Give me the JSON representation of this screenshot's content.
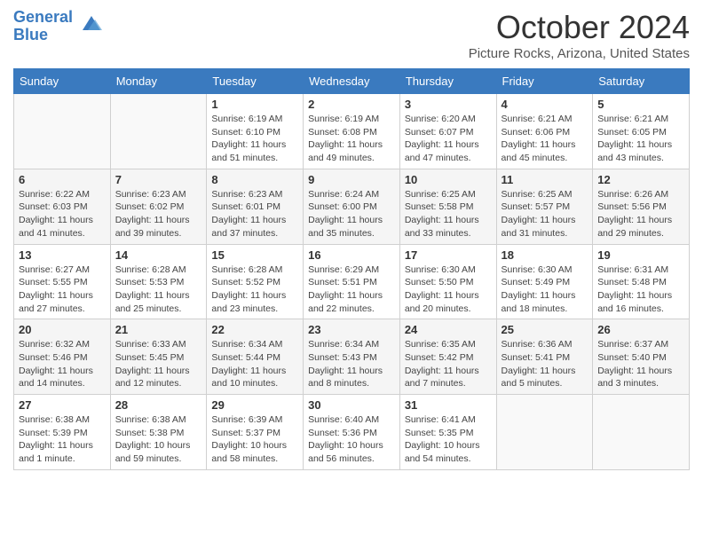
{
  "header": {
    "logo_text_general": "General",
    "logo_text_blue": "Blue",
    "month_title": "October 2024",
    "location": "Picture Rocks, Arizona, United States"
  },
  "calendar": {
    "days_of_week": [
      "Sunday",
      "Monday",
      "Tuesday",
      "Wednesday",
      "Thursday",
      "Friday",
      "Saturday"
    ],
    "weeks": [
      [
        {
          "day": "",
          "info": ""
        },
        {
          "day": "",
          "info": ""
        },
        {
          "day": "1",
          "info": "Sunrise: 6:19 AM\nSunset: 6:10 PM\nDaylight: 11 hours and 51 minutes."
        },
        {
          "day": "2",
          "info": "Sunrise: 6:19 AM\nSunset: 6:08 PM\nDaylight: 11 hours and 49 minutes."
        },
        {
          "day": "3",
          "info": "Sunrise: 6:20 AM\nSunset: 6:07 PM\nDaylight: 11 hours and 47 minutes."
        },
        {
          "day": "4",
          "info": "Sunrise: 6:21 AM\nSunset: 6:06 PM\nDaylight: 11 hours and 45 minutes."
        },
        {
          "day": "5",
          "info": "Sunrise: 6:21 AM\nSunset: 6:05 PM\nDaylight: 11 hours and 43 minutes."
        }
      ],
      [
        {
          "day": "6",
          "info": "Sunrise: 6:22 AM\nSunset: 6:03 PM\nDaylight: 11 hours and 41 minutes."
        },
        {
          "day": "7",
          "info": "Sunrise: 6:23 AM\nSunset: 6:02 PM\nDaylight: 11 hours and 39 minutes."
        },
        {
          "day": "8",
          "info": "Sunrise: 6:23 AM\nSunset: 6:01 PM\nDaylight: 11 hours and 37 minutes."
        },
        {
          "day": "9",
          "info": "Sunrise: 6:24 AM\nSunset: 6:00 PM\nDaylight: 11 hours and 35 minutes."
        },
        {
          "day": "10",
          "info": "Sunrise: 6:25 AM\nSunset: 5:58 PM\nDaylight: 11 hours and 33 minutes."
        },
        {
          "day": "11",
          "info": "Sunrise: 6:25 AM\nSunset: 5:57 PM\nDaylight: 11 hours and 31 minutes."
        },
        {
          "day": "12",
          "info": "Sunrise: 6:26 AM\nSunset: 5:56 PM\nDaylight: 11 hours and 29 minutes."
        }
      ],
      [
        {
          "day": "13",
          "info": "Sunrise: 6:27 AM\nSunset: 5:55 PM\nDaylight: 11 hours and 27 minutes."
        },
        {
          "day": "14",
          "info": "Sunrise: 6:28 AM\nSunset: 5:53 PM\nDaylight: 11 hours and 25 minutes."
        },
        {
          "day": "15",
          "info": "Sunrise: 6:28 AM\nSunset: 5:52 PM\nDaylight: 11 hours and 23 minutes."
        },
        {
          "day": "16",
          "info": "Sunrise: 6:29 AM\nSunset: 5:51 PM\nDaylight: 11 hours and 22 minutes."
        },
        {
          "day": "17",
          "info": "Sunrise: 6:30 AM\nSunset: 5:50 PM\nDaylight: 11 hours and 20 minutes."
        },
        {
          "day": "18",
          "info": "Sunrise: 6:30 AM\nSunset: 5:49 PM\nDaylight: 11 hours and 18 minutes."
        },
        {
          "day": "19",
          "info": "Sunrise: 6:31 AM\nSunset: 5:48 PM\nDaylight: 11 hours and 16 minutes."
        }
      ],
      [
        {
          "day": "20",
          "info": "Sunrise: 6:32 AM\nSunset: 5:46 PM\nDaylight: 11 hours and 14 minutes."
        },
        {
          "day": "21",
          "info": "Sunrise: 6:33 AM\nSunset: 5:45 PM\nDaylight: 11 hours and 12 minutes."
        },
        {
          "day": "22",
          "info": "Sunrise: 6:34 AM\nSunset: 5:44 PM\nDaylight: 11 hours and 10 minutes."
        },
        {
          "day": "23",
          "info": "Sunrise: 6:34 AM\nSunset: 5:43 PM\nDaylight: 11 hours and 8 minutes."
        },
        {
          "day": "24",
          "info": "Sunrise: 6:35 AM\nSunset: 5:42 PM\nDaylight: 11 hours and 7 minutes."
        },
        {
          "day": "25",
          "info": "Sunrise: 6:36 AM\nSunset: 5:41 PM\nDaylight: 11 hours and 5 minutes."
        },
        {
          "day": "26",
          "info": "Sunrise: 6:37 AM\nSunset: 5:40 PM\nDaylight: 11 hours and 3 minutes."
        }
      ],
      [
        {
          "day": "27",
          "info": "Sunrise: 6:38 AM\nSunset: 5:39 PM\nDaylight: 11 hours and 1 minute."
        },
        {
          "day": "28",
          "info": "Sunrise: 6:38 AM\nSunset: 5:38 PM\nDaylight: 10 hours and 59 minutes."
        },
        {
          "day": "29",
          "info": "Sunrise: 6:39 AM\nSunset: 5:37 PM\nDaylight: 10 hours and 58 minutes."
        },
        {
          "day": "30",
          "info": "Sunrise: 6:40 AM\nSunset: 5:36 PM\nDaylight: 10 hours and 56 minutes."
        },
        {
          "day": "31",
          "info": "Sunrise: 6:41 AM\nSunset: 5:35 PM\nDaylight: 10 hours and 54 minutes."
        },
        {
          "day": "",
          "info": ""
        },
        {
          "day": "",
          "info": ""
        }
      ]
    ]
  }
}
